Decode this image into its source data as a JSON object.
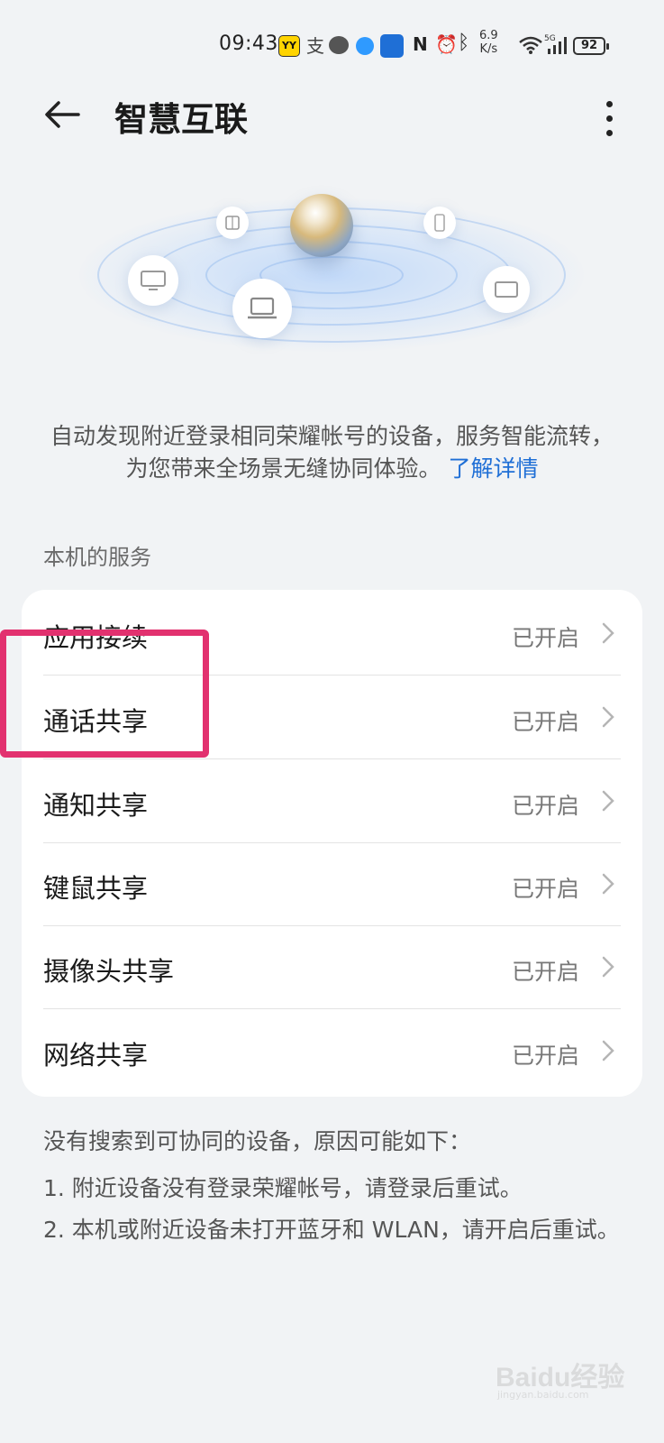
{
  "status_bar": {
    "time": "09:43",
    "net_speed_value": "6.9",
    "net_speed_unit": "K/s",
    "battery": "92",
    "icons": [
      "yy-app-icon",
      "alipay-icon",
      "message-icon",
      "browser-icon",
      "news-app-icon",
      "nfc-icon",
      "alarm-icon",
      "bluetooth-icon",
      "wifi-icon",
      "5g-signal-icon",
      "battery-icon"
    ]
  },
  "header": {
    "title": "智慧互联"
  },
  "description": {
    "text": "自动发现附近登录相同荣耀帐号的设备，服务智能流转，为您带来全场景无缝协同体验。",
    "link": "了解详情"
  },
  "section": {
    "title": "本机的服务"
  },
  "services": [
    {
      "label": "应用接续",
      "status": "已开启"
    },
    {
      "label": "通话共享",
      "status": "已开启"
    },
    {
      "label": "通知共享",
      "status": "已开启"
    },
    {
      "label": "键鼠共享",
      "status": "已开启"
    },
    {
      "label": "摄像头共享",
      "status": "已开启"
    },
    {
      "label": "网络共享",
      "status": "已开启"
    }
  ],
  "notes": {
    "title": "没有搜索到可协同的设备，原因可能如下：",
    "items": [
      "1. 附近设备没有登录荣耀帐号，请登录后重试。",
      "2. 本机或附近设备未打开蓝牙和 WLAN，请开启后重试。"
    ]
  },
  "watermark": {
    "text": "Baidu经验",
    "sub": "jingyan.baidu.com"
  },
  "colors": {
    "background": "#f1f3f5",
    "link": "#1f6fd6",
    "highlight": "#e2316f"
  }
}
